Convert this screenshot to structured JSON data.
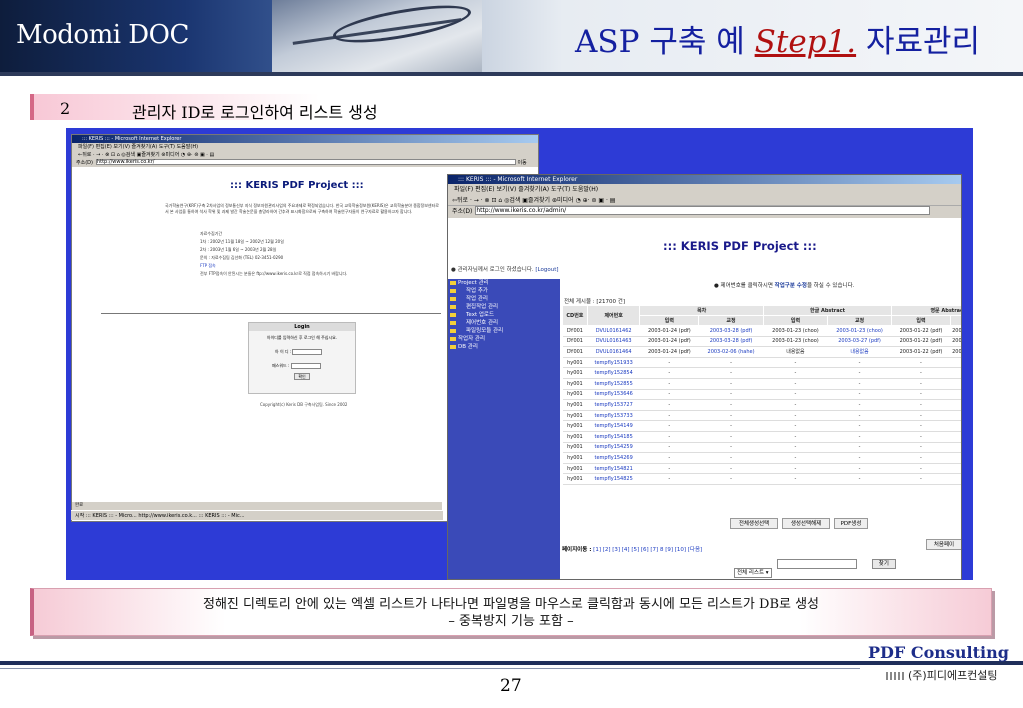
{
  "header": {
    "brand": "Modomi DOC",
    "title_prefix": "ASP 구축 예",
    "title_step": "Step1.",
    "title_suffix": "자료관리"
  },
  "step": {
    "number": "2",
    "title": "관리자 ID로 로그인하여 리스트 생성"
  },
  "ie_left": {
    "title": "::: KERIS ::: - Microsoft Internet Explorer",
    "menu": "파일(F)  편집(E)  보기(V)  즐겨찾기(A)  도구(T)  도움말(H)",
    "toolbar": "←뒤로 · → · ⊗ ⊡ ⌂  ◎검색  ▣즐겨찾기  ⊛미디어  ◔  ⊕· ⊜ ▣ · ▤",
    "address_label": "주소(D)",
    "address": "http://www.ikeris.co.kr/",
    "go": "이동",
    "page_title": "::: KERIS PDF Project :::",
    "intro": "국가학술연구(KRF)구축 2차사업의 정보통신부 지식 정보자원관리사업의 주요과제로 확정되었습니다. 한국 교육학술정보원(KERIS)은 교육학술분야 종합정보센터로서 본 사업을 통하여 석사 학위 및 과제 발간 학술논문을 총망라하여 간추려 표시화함으로써 구축하여 학술연구자들이 연구자료로 활용하고자 합니다.",
    "bullets": [
      "자료수집기간",
      "1차 : 2002년 11월 18일 ~ 2002년 12월 20일",
      "2차 : 2003년 1월 6일 ~ 2003년 2월 28일",
      "문의 : 자료수집팀 김선화 (TEL) 02-3451-0290",
      "FTP 접속",
      "전부 FTP접속이 안된시는 분들은 ftp://www.ikeris.co.kr로 직접 접속하시기 바랍니다."
    ],
    "login": {
      "heading": "Login",
      "hint": "아이디를 입력하신 후 로그인 해 주십시요.",
      "id_label": "아 이 디 :",
      "pw_label": "패스워드 :",
      "submit": "확인"
    },
    "copyright": "Copyright(c) Keris DB 구축사업팀. Since 2002",
    "status": "완료",
    "taskbar": "시작   ::: KERIS ::: - Micro...   http://www.ikeris.co.k...   ::: KERIS ::: - Mic..."
  },
  "ie_right": {
    "title": "::: KERIS ::: - Microsoft Internet Explorer",
    "menu": "파일(F)  편집(E)  보기(V)  즐겨찾기(A)  도구(T)  도움말(H)",
    "toolbar": "⇦뒤로 · → · ⊗ ⊡ ⌂  ◎검색  ▣즐겨찾기  ⊛미디어  ◔  ⊕· ⊜ ▣ · ▤",
    "address_label": "주소(D)",
    "address": "http://www.ikeris.co.kr/admin/",
    "page_title": "::: KERIS PDF Project :::",
    "logout_text": "관리자님께서 로그인 하셨습니다.",
    "logout_link": "[Logout]",
    "tree": [
      "Project 관리",
      "작업 추가",
      "작업 관리",
      "편집작업 관리",
      "Text 업로드",
      "제어번호 관리",
      "파일링모듈 관리",
      "작업자 관리",
      "DB 관리"
    ],
    "notice_pre": "● 제어번호를 클릭하시면",
    "notice_bold": "작업구분 수정",
    "notice_post": "을 하실 수 있습니다.",
    "total": "전체 게시물 : [21700 건]",
    "columns": {
      "cd": "CD번호",
      "ctrl": "제어번호",
      "toc": "목차",
      "kor": "한글 Abstract",
      "eng": "영문 Abstrac",
      "input": "입력",
      "proof": "교정"
    },
    "rows": [
      [
        "DY001",
        "DVUL0161462",
        "2003-01-24 (pdf)",
        "2003-03-28 (pdf)",
        "2003-01-23 (choo)",
        "2003-01-23 (choo)",
        "2003-01-22 (pdf)",
        "200"
      ],
      [
        "DY001",
        "DVUL0161463",
        "2003-01-24 (pdf)",
        "2003-03-28 (pdf)",
        "2003-01-23 (choo)",
        "2003-03-27 (pdf)",
        "2003-01-22 (pdf)",
        "200"
      ],
      [
        "DY001",
        "DVUL0161464",
        "2003-01-24 (pdf)",
        "2003-02-06 (hahe)",
        "내용없음",
        "내용없음",
        "2003-01-22 (pdf)",
        "200"
      ],
      [
        "hy001",
        "tempfly151933",
        "-",
        "-",
        "-",
        "-",
        "-",
        ""
      ],
      [
        "hy001",
        "tempfly152854",
        "-",
        "-",
        "-",
        "-",
        "-",
        ""
      ],
      [
        "hy001",
        "tempfly152855",
        "-",
        "-",
        "-",
        "-",
        "-",
        ""
      ],
      [
        "hy001",
        "tempfly153646",
        "-",
        "-",
        "-",
        "-",
        "-",
        ""
      ],
      [
        "hy001",
        "tempfly153727",
        "-",
        "-",
        "-",
        "-",
        "-",
        ""
      ],
      [
        "hy001",
        "tempfly153733",
        "-",
        "-",
        "-",
        "-",
        "-",
        ""
      ],
      [
        "hy001",
        "tempfly154149",
        "-",
        "-",
        "-",
        "-",
        "-",
        ""
      ],
      [
        "hy001",
        "tempfly154185",
        "-",
        "-",
        "-",
        "-",
        "-",
        ""
      ],
      [
        "hy001",
        "tempfly154259",
        "-",
        "-",
        "-",
        "-",
        "-",
        ""
      ],
      [
        "hy001",
        "tempfly154269",
        "-",
        "-",
        "-",
        "-",
        "-",
        ""
      ],
      [
        "hy001",
        "tempfly154821",
        "-",
        "-",
        "-",
        "-",
        "-",
        ""
      ],
      [
        "hy001",
        "tempfly154825",
        "-",
        "-",
        "-",
        "-",
        "-",
        ""
      ]
    ],
    "buttons": {
      "select_all": "전체생성선택",
      "deselect_all": "생성선택해제",
      "pdf_make": "PDF생성",
      "first_page": "처음페이"
    },
    "pager_label": "페이지이동 :",
    "pager": "[1] [2] [3] [4] [5] [6] [7] 8 [9] [10] [다음]",
    "search_select": "전체 리스트",
    "search_btn": "찾기"
  },
  "caption": {
    "line1": "정해진 디렉토리 안에 있는 엑셀 리스트가 나타나면 파일명을 마우스로 클릭함과 동시에 모든 리스트가 DB로 생성",
    "line2": "– 중복방지 기능 포함 –"
  },
  "footer": {
    "page": "27",
    "company_en": "PDF Consulting",
    "company_ko": "(주)피디에프컨설팅"
  }
}
